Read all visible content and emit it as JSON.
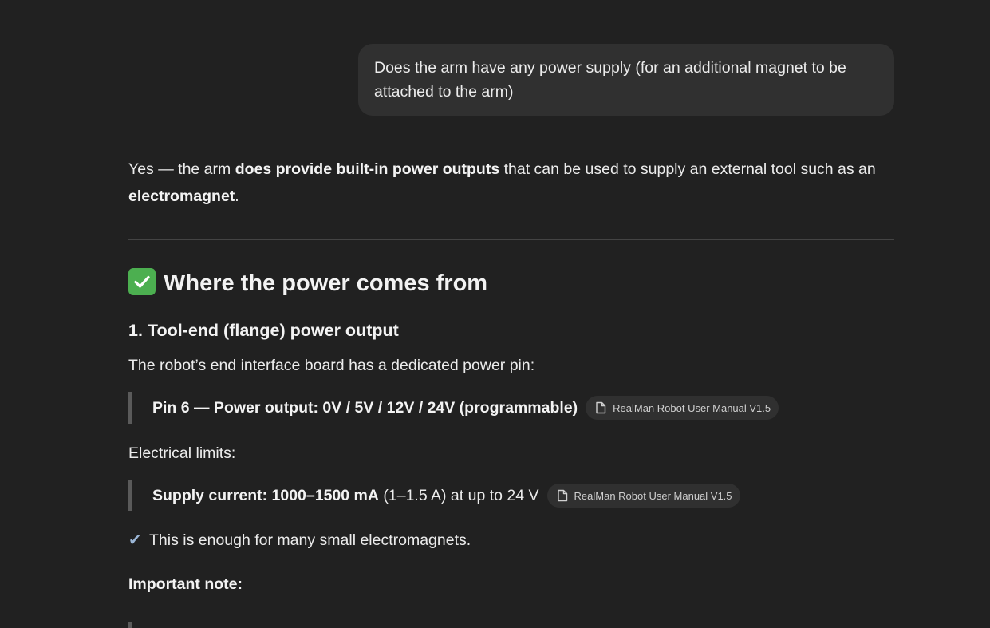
{
  "user_message": "Does the arm have any power supply (for an additional magnet to be attached to the arm)",
  "answer": {
    "intro_prefix": "Yes — the arm ",
    "intro_bold1": "does provide built-in power outputs",
    "intro_mid": " that can be used to supply an external tool such as an ",
    "intro_bold2": "electromagnet",
    "intro_suffix": ".",
    "heading_main": "Where the power comes from",
    "heading_main_icon": "white-check-mark-emoji",
    "subheading": "1. Tool-end (flange) power output",
    "para_pin": "The robot’s end interface board has a dedicated power pin:",
    "quote1_bold": "Pin 6 — Power output: 0V / 5V / 12V / 24V (programmable)",
    "citation1": "RealMan Robot User Manual V1.5",
    "para_limits": "Electrical limits:",
    "quote2_bold": "Supply current: 1000–1500 mA",
    "quote2_rest": " (1–1.5 A) at up to 24 V",
    "citation2": "RealMan Robot User Manual V1.5",
    "check_line": "This is enough for many small electromagnets.",
    "important_note": "Important note:"
  },
  "colors": {
    "background": "#212121",
    "user_bubble": "#303030",
    "text": "#ececec",
    "citation_chip": "#303030",
    "check_emoji": "#4caf50"
  }
}
